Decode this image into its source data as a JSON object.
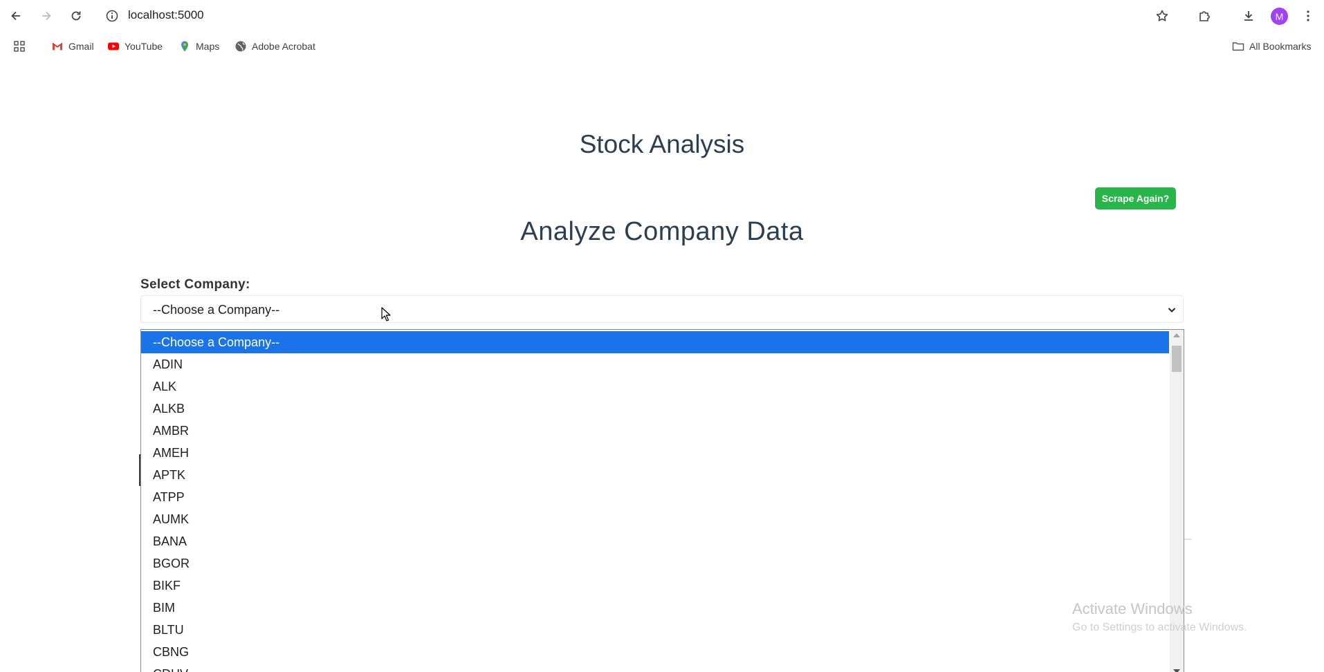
{
  "browser": {
    "url": "localhost:5000",
    "avatar_letter": "M",
    "bookmarks": [
      {
        "label": "Gmail",
        "icon": "gmail-icon"
      },
      {
        "label": "YouTube",
        "icon": "youtube-icon"
      },
      {
        "label": "Maps",
        "icon": "maps-icon"
      },
      {
        "label": "Adobe Acrobat",
        "icon": "globe-icon"
      }
    ],
    "all_bookmarks": "All Bookmarks"
  },
  "page": {
    "title": "Stock Analysis",
    "subtitle": "Analyze Company Data",
    "scrape_button": "Scrape Again?",
    "select_label": "Select Company:",
    "select_value": "--Choose a Company--",
    "options": [
      "--Choose a Company--",
      "ADIN",
      "ALK",
      "ALKB",
      "AMBR",
      "AMEH",
      "APTK",
      "ATPP",
      "AUMK",
      "BANA",
      "BGOR",
      "BIKF",
      "BIM",
      "BLTU",
      "CBNG",
      "CDHV"
    ],
    "selected_option": "--Choose a Company--"
  },
  "watermark": {
    "title": "Activate Windows",
    "subtitle": "Go to Settings to activate Windows."
  },
  "colors": {
    "heading": "#2c3e50",
    "scrape_button": "#28b64a",
    "selection": "#1a73e8"
  }
}
